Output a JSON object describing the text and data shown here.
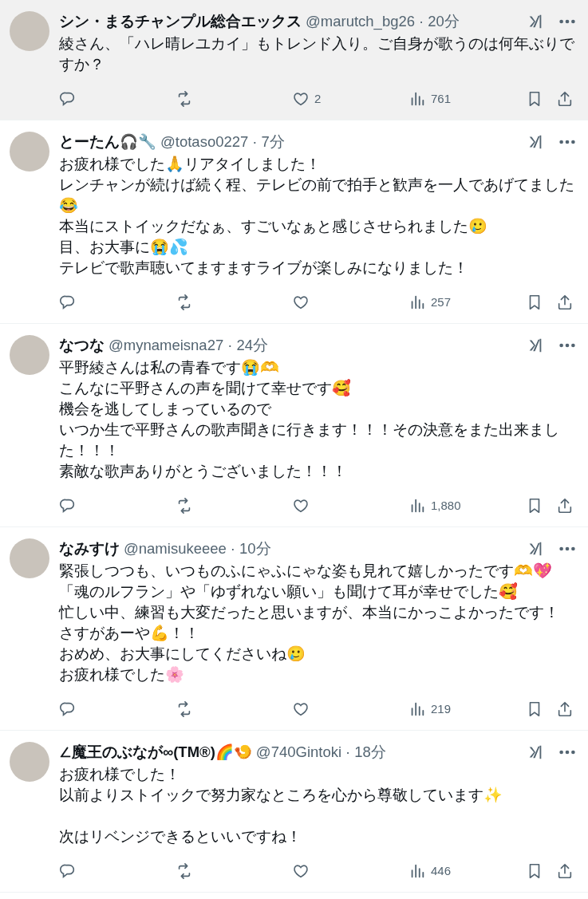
{
  "replies": [
    {
      "selected": true,
      "name": "シン・まるチャンプル総合エックス",
      "handle": "@marutch_bg26",
      "separator": "·",
      "time": "20分",
      "paragraphs": [
        [
          "綾さん、「ハレ晴レユカイ」もトレンド入り。ご自身が歌うのは何年ぶりですか？"
        ]
      ],
      "likes": "2",
      "views": "761"
    },
    {
      "selected": false,
      "name": "とーたん🎧🔧",
      "handle": "@totaso0227",
      "separator": "·",
      "time": "7分",
      "paragraphs": [
        [
          "お疲れ様でした🙏リアタイしました！",
          "レンチャンが続けば続く程、テレビの前で拍手と歓声を一人であげてました😂",
          "本当にストイックだなぁ、すごいなぁと感じさせられました🥲",
          "目、お大事に😭💦",
          "テレビで歌声聴いてますますライブが楽しみになりました！"
        ]
      ],
      "views": "257"
    },
    {
      "selected": false,
      "name": "なつな",
      "handle": "@mynameisna27",
      "separator": "·",
      "time": "24分",
      "paragraphs": [
        [
          "平野綾さんは私の青春です😭🫶",
          "こんなに平野さんの声を聞けて幸せです🥰",
          "機会を逃してしまっているので",
          "いつか生で平野さんの歌声聞きに行きます！！！その決意をまた出来ました！！！",
          "素敵な歌声ありがとうございました！！！"
        ]
      ],
      "views": "1,880"
    },
    {
      "selected": false,
      "name": "なみすけ",
      "handle": "@namisukeeee",
      "separator": "·",
      "time": "10分",
      "paragraphs": [
        [
          "緊張しつつも、いつものふにゃふにゃな姿も見れて嬉しかったです🫶💖",
          "「魂のルフラン」や「ゆずれない願い」も聞けて耳が幸せでした🥰",
          "忙しい中、練習も大変だったと思いますが、本当にかっこよかったです！",
          "さすがあーや💪！！",
          "おめめ、お大事にしてくださいね🥲",
          "お疲れ様でした🌸"
        ]
      ],
      "views": "219"
    },
    {
      "selected": false,
      "name": "∠魔王のぶなが∞(TM®)🌈🍤",
      "handle": "@740Gintoki",
      "separator": "·",
      "time": "18分",
      "paragraphs": [
        [
          "お疲れ様でした！",
          "以前よりストイックで努力家なところを心から尊敬しています✨"
        ],
        [
          "次はリベンジできるといいですね！"
        ]
      ],
      "views": "446"
    }
  ]
}
